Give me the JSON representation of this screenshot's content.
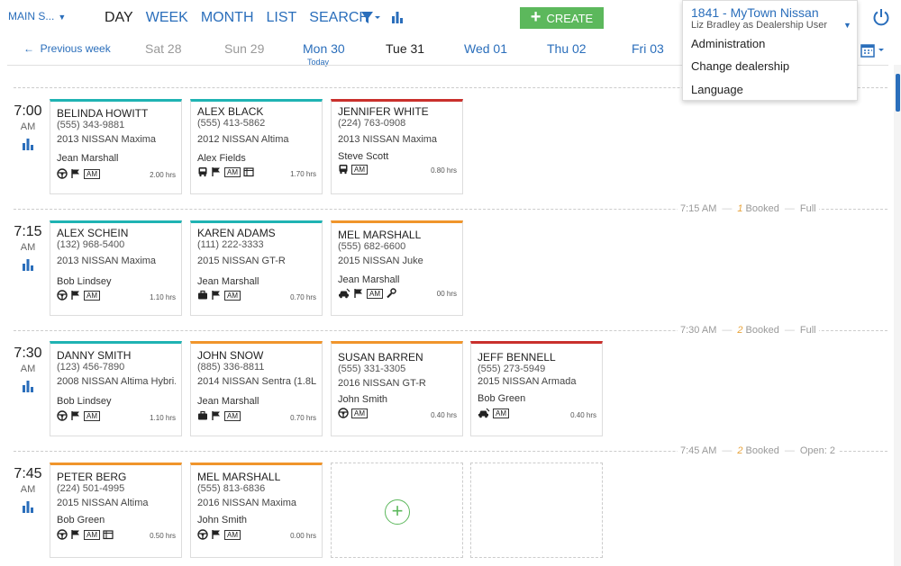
{
  "header": {
    "store": "MAIN S...",
    "views": [
      "DAY",
      "WEEK",
      "MONTH",
      "LIST",
      "SEARCH"
    ],
    "active_view": "DAY",
    "create_label": "CREATE"
  },
  "dealer": {
    "name": "1841 - MyTown Nissan",
    "user": "Liz Bradley as Dealership User",
    "menu": [
      "Administration",
      "Change dealership",
      "Language"
    ]
  },
  "datebar": {
    "prev_label": "Previous week",
    "days": [
      "Sat 28",
      "Sun 29",
      "Mon 30",
      "Tue 31",
      "Wed 01",
      "Thu 02",
      "Fri 03"
    ],
    "today_label": "Today"
  },
  "slots": [
    {
      "time": "7:00",
      "ampm": "AM"
    },
    {
      "time": "7:15",
      "ampm": "AM",
      "info_time": "7:15 AM",
      "booked_num": "1",
      "booked_label": "Booked",
      "status": "Full"
    },
    {
      "time": "7:30",
      "ampm": "AM",
      "info_time": "7:30 AM",
      "booked_num": "2",
      "booked_label": "Booked",
      "status": "Full"
    },
    {
      "time": "7:45",
      "ampm": "AM",
      "info_time": "7:45 AM",
      "booked_num": "2",
      "booked_label": "Booked",
      "status": "Open: 2"
    }
  ],
  "cards": [
    {
      "name": "BELINDA HOWITT",
      "phone": "(555) 343-9881",
      "vehicle": "2013 NISSAN Maxima",
      "advisor": "Jean Marshall",
      "hours": "2.00 hrs",
      "am": "AM"
    },
    {
      "name": "ALEX BLACK",
      "phone": "(555) 413-5862",
      "vehicle": "2012 NISSAN Altima",
      "advisor": "Alex Fields",
      "hours": "1.70 hrs",
      "am": "AM"
    },
    {
      "name": "JENNIFER WHITE",
      "phone": "(224) 763-0908",
      "vehicle": "2013 NISSAN Maxima",
      "advisor": "Steve Scott",
      "hours": "0.80 hrs",
      "am": "AM"
    },
    {
      "name": "ALEX SCHEIN",
      "phone": "(132) 968-5400",
      "vehicle": "2013 NISSAN Maxima",
      "advisor": "Bob Lindsey",
      "hours": "1.10 hrs",
      "am": "AM"
    },
    {
      "name": "KAREN ADAMS",
      "phone": "(111) 222-3333",
      "vehicle": "2015 NISSAN GT-R",
      "advisor": "Jean Marshall",
      "hours": "0.70 hrs",
      "am": "AM"
    },
    {
      "name": "MEL MARSHALL",
      "phone": "(555) 682-6600",
      "vehicle": "2015 NISSAN Juke",
      "advisor": "Jean Marshall",
      "hours": "00 hrs",
      "am": "AM"
    },
    {
      "name": "DANNY SMITH",
      "phone": "(123) 456-7890",
      "vehicle": "2008 NISSAN Altima Hybri...",
      "advisor": "Bob Lindsey",
      "hours": "1.10 hrs",
      "am": "AM"
    },
    {
      "name": "JOHN SNOW",
      "phone": "(885) 336-8811",
      "vehicle": "2014 NISSAN Sentra (1.8L)",
      "advisor": "Jean Marshall",
      "hours": "0.70 hrs",
      "am": "AM"
    },
    {
      "name": "SUSAN BARREN",
      "phone": "(555) 331-3305",
      "vehicle": "2016 NISSAN GT-R",
      "advisor": "John Smith",
      "hours": "0.40 hrs",
      "am": "AM"
    },
    {
      "name": "JEFF BENNELL",
      "phone": "(555) 273-5949",
      "vehicle": "2015 NISSAN Armada",
      "advisor": "Bob Green",
      "hours": "0.40 hrs",
      "am": "AM"
    },
    {
      "name": "PETER BERG",
      "phone": "(224) 501-4995",
      "vehicle": "2015 NISSAN Altima",
      "advisor": "Bob Green",
      "hours": "0.50 hrs",
      "am": "AM"
    },
    {
      "name": "MEL MARSHALL",
      "phone": "(555) 813-6836",
      "vehicle": "2016 NISSAN Maxima",
      "advisor": "John Smith",
      "hours": "0.00 hrs",
      "am": "AM"
    }
  ],
  "colors": {
    "accent": "#2a6ebb",
    "create": "#5cb85c",
    "teal": "#1fb3b3",
    "red": "#c9302c",
    "orange": "#f0952b",
    "booked": "#e8a33b"
  }
}
